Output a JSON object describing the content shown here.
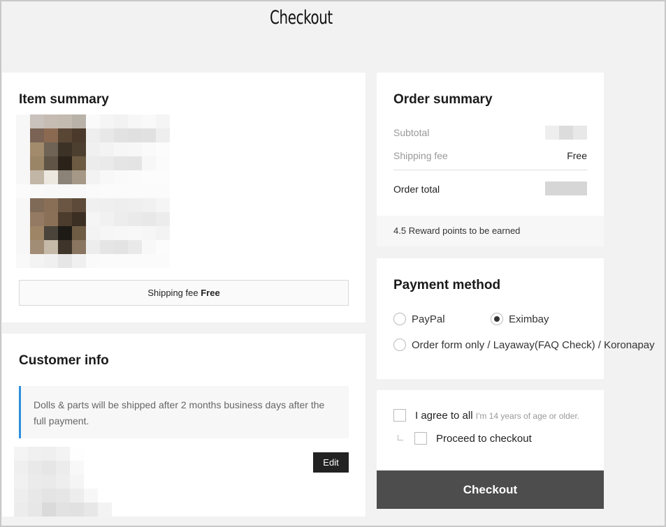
{
  "page": {
    "title": "Checkout"
  },
  "item_summary": {
    "heading": "Item summary",
    "shipping_fee_label": "Shipping fee",
    "shipping_fee_value": "Free"
  },
  "customer_info": {
    "heading": "Customer info",
    "notice": "Dolls & parts will be shipped after 2 months business days after the full payment.",
    "edit_label": "Edit"
  },
  "order_summary": {
    "heading": "Order summary",
    "subtotal_label": "Subtotal",
    "shipping_label": "Shipping fee",
    "shipping_value": "Free",
    "total_label": "Order total",
    "reward_points": "4.5",
    "reward_text": "Reward points to be earned"
  },
  "payment": {
    "heading": "Payment method",
    "options": [
      {
        "label": "PayPal",
        "selected": false
      },
      {
        "label": "Eximbay",
        "selected": true
      },
      {
        "label": "Order form only / Layaway(FAQ Check) / Koronapay",
        "selected": false
      }
    ]
  },
  "agreement": {
    "agree_all_label": "I agree to all",
    "age_note": "I'm 14 years of age or older.",
    "proceed_label": "Proceed to checkout"
  },
  "checkout_button": "Checkout",
  "colors": {
    "accent_bar": "#2d8fdd",
    "button_dark": "#4d4d4d",
    "edit_button": "#222222"
  }
}
